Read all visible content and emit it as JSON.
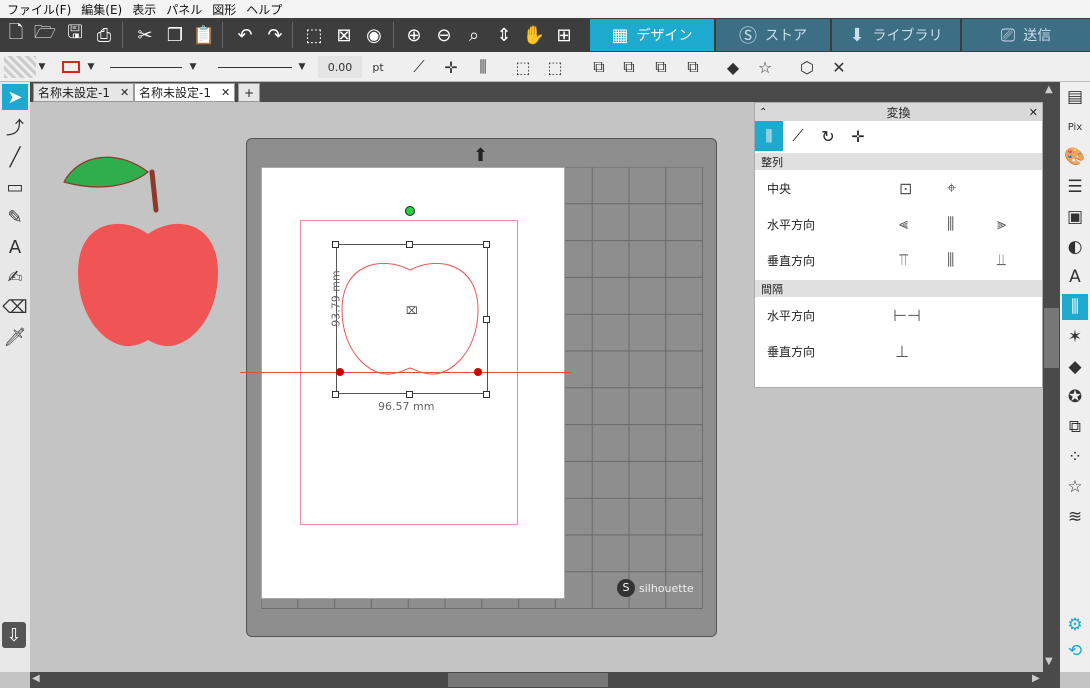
{
  "menu": {
    "file": "ファイル(F)",
    "edit": "編集(E)",
    "view": "表示",
    "panel": "パネル",
    "shape": "図形",
    "help": "ヘルプ"
  },
  "nav": {
    "design": "デザイン",
    "store": "ストア",
    "library": "ライブラリ",
    "send": "送信"
  },
  "line": {
    "width_value": "0.00",
    "unit": "pt"
  },
  "tabs": [
    {
      "label": "名称未設定-1"
    },
    {
      "label": "名称未設定-1"
    }
  ],
  "transform": {
    "title": "変換",
    "align_section": "整列",
    "center_label": "中央",
    "horizontal_label": "水平方向",
    "vertical_label": "垂直方向",
    "spacing_section": "間隔",
    "spacing_horizontal_label": "水平方向",
    "spacing_vertical_label": "垂直方向"
  },
  "selection": {
    "height_label": "93.79 mm",
    "width_label": "96.57 mm"
  },
  "mat": {
    "brand": "silhouette"
  },
  "colors": {
    "accent": "#1ea9cf",
    "apple_red": "#f05455",
    "leaf_green": "#2fae4d",
    "stem": "#8b3b2b"
  }
}
